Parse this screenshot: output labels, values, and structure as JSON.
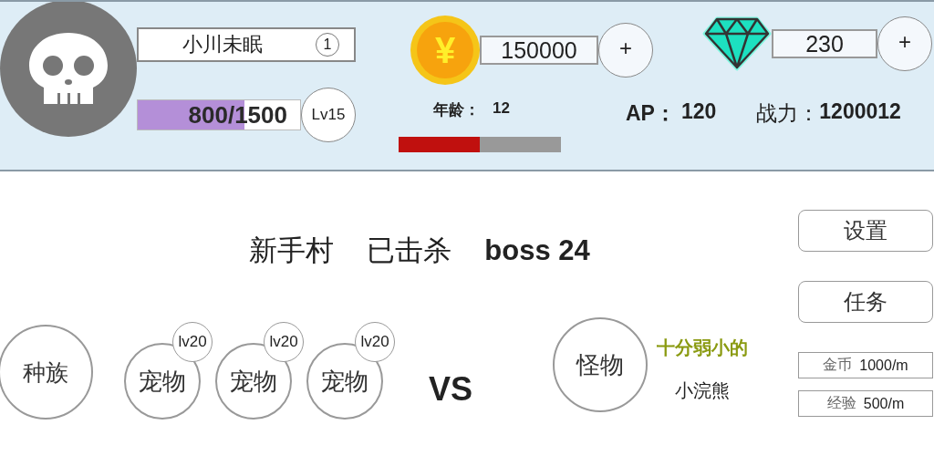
{
  "player": {
    "name": "小川未眠",
    "badge": "1",
    "exp": {
      "text": "800/1500",
      "level": 0.66
    },
    "rank": "Lv15"
  },
  "gold": {
    "symbol": "¥",
    "amount": "150000",
    "add": "+"
  },
  "gems": {
    "amount": "230",
    "add": "+"
  },
  "age": {
    "label": "年龄：",
    "value": "12"
  },
  "age_bar": {
    "level": 0.5
  },
  "ap": {
    "label": "AP：",
    "value": "120"
  },
  "power": {
    "label": "战力：",
    "value": "1200012"
  },
  "stage": {
    "name": "新手村",
    "kills_label": "已击杀",
    "kills": "boss 24"
  },
  "team": [
    {
      "kind": "race",
      "label": "种族"
    },
    {
      "kind": "pet",
      "label": "宠物",
      "badge": "lv20"
    },
    {
      "kind": "pet",
      "label": "宠物",
      "badge": "lv20"
    },
    {
      "kind": "pet",
      "label": "宠物",
      "badge": "lv20"
    }
  ],
  "vs": "VS",
  "monster": {
    "label": "怪物",
    "adjective": "十分弱小的",
    "name": "小浣熊"
  },
  "buttons": [
    "设置",
    "任务"
  ],
  "rates": [
    {
      "label": "金币",
      "value": "1000/m"
    },
    {
      "label": "经验",
      "value": "500/m"
    }
  ]
}
